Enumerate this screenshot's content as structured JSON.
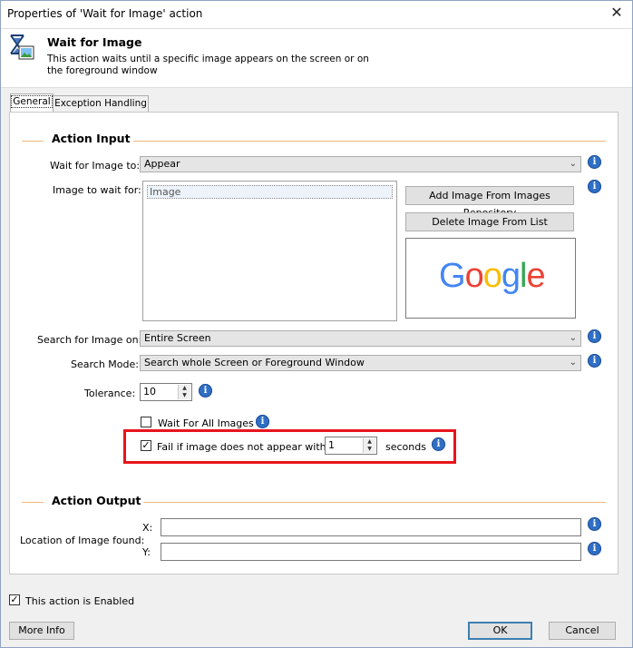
{
  "window": {
    "title": "Properties of 'Wait for Image' action",
    "close_glyph": "✕"
  },
  "header": {
    "icon": "hourglass-image-icon",
    "title": "Wait for Image",
    "description": "This action waits until a specific image appears on the screen or on the foreground window"
  },
  "tabs": [
    {
      "label": "General",
      "active": true
    },
    {
      "label": "Exception Handling",
      "active": false
    }
  ],
  "action_input": {
    "section_title": "Action Input",
    "wait_for_image_to": {
      "label": "Wait for Image to:",
      "value": "Appear"
    },
    "image_to_wait_for": {
      "label": "Image to wait for:",
      "items": [
        "Image"
      ]
    },
    "add_button": "Add Image From Images Repository",
    "delete_button": "Delete Image From List",
    "preview_logo": {
      "letters": [
        "G",
        "o",
        "o",
        "g",
        "l",
        "e"
      ],
      "colors": [
        "#4285F4",
        "#EA4335",
        "#FBBC05",
        "#4285F4",
        "#34A853",
        "#EA4335"
      ]
    },
    "search_for_image_on": {
      "label": "Search for Image on:",
      "value": "Entire Screen"
    },
    "search_mode": {
      "label": "Search Mode:",
      "value": "Search whole Screen or Foreground Window"
    },
    "tolerance": {
      "label": "Tolerance:",
      "value": "10"
    },
    "wait_for_all_images": {
      "label": "Wait For All Images",
      "checked": false
    },
    "fail_if_not_appear": {
      "label": "Fail if image does not appear within:",
      "checked": true,
      "value": "1",
      "unit": "seconds"
    }
  },
  "action_output": {
    "section_title": "Action Output",
    "location_label": "Location of Image found:",
    "x_label": "X:",
    "y_label": "Y:",
    "x_value": "",
    "y_value": ""
  },
  "footer": {
    "enabled_label": "This action is Enabled",
    "enabled_checked": true,
    "more_info": "More Info",
    "ok": "OK",
    "cancel": "Cancel"
  },
  "info_glyph": "i",
  "colors": {
    "highlight": "#e8141c",
    "section_line": "#f0b87a",
    "info": "#2f6fc4"
  }
}
